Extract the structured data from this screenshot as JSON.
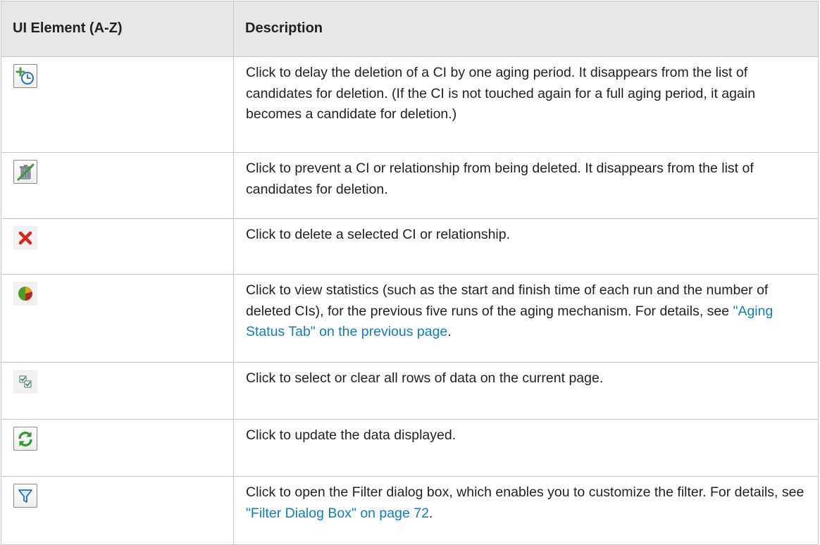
{
  "table": {
    "headers": {
      "element": "UI Element (A-Z)",
      "description": "Description"
    },
    "rows": [
      {
        "icon": "clock-plus-icon",
        "desc": "Click to delay the deletion of a CI by one aging period. It disappears from the list of candidates for deletion. (If the CI is not touched again for a full aging period, it again becomes a candidate for deletion.)"
      },
      {
        "icon": "trash-slash-icon",
        "desc": "Click to prevent a CI or relationship from being deleted. It disappears from the list of candidates for deletion."
      },
      {
        "icon": "delete-x-icon",
        "desc": "Click to delete a selected CI or relationship."
      },
      {
        "icon": "pie-chart-icon",
        "desc_before": "Click to view statistics (such as the start and finish time of each run and the number of deleted CIs), for the previous five runs of the aging mechanism. For details, see ",
        "link": "\"Aging Status Tab\" on the previous page",
        "desc_after": "."
      },
      {
        "icon": "select-all-icon",
        "desc": "Click to select or clear all rows of data on the current page."
      },
      {
        "icon": "refresh-icon",
        "desc": "Click to update the data displayed."
      },
      {
        "icon": "filter-icon",
        "desc_before": "Click to open the Filter dialog box, which enables you to customize the filter. For details, see ",
        "link": "\"Filter Dialog Box\" on page 72",
        "desc_after": "."
      }
    ]
  }
}
